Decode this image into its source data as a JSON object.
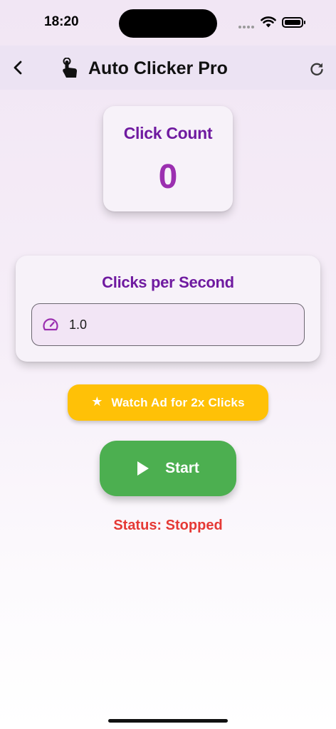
{
  "status_bar": {
    "time": "18:20"
  },
  "app_bar": {
    "title": "Auto Clicker Pro",
    "back_icon": "chevron-left-icon",
    "app_icon": "touch-hand-icon",
    "refresh_icon": "refresh-icon"
  },
  "click_count": {
    "label": "Click Count",
    "value": "0"
  },
  "clicks_per_second": {
    "label": "Clicks per Second",
    "input_value": "1.0",
    "input_icon": "speed-gauge-icon"
  },
  "ad_button": {
    "label": "Watch Ad for 2x Clicks",
    "icon": "star-icon"
  },
  "start_button": {
    "label": "Start",
    "icon": "play-icon"
  },
  "status": {
    "prefix": "Status:",
    "value": "Stopped"
  },
  "colors": {
    "primary_purple": "#6f1aa0",
    "count_purple": "#9b2fb0",
    "ad_amber": "#ffc107",
    "start_green": "#4caf50",
    "status_red": "#e53935"
  }
}
